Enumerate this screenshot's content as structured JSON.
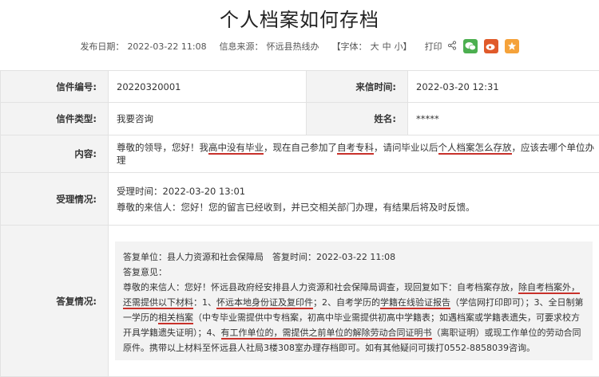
{
  "title": "个人档案如何存档",
  "meta": {
    "publish_label": "发布日期：",
    "publish_date": "2022-03-22 11:08",
    "source_label": "信息来源：",
    "source": "怀远县热线办",
    "font_prefix": "【字体：",
    "font_large": "大",
    "font_medium": "中",
    "font_small": "小】",
    "print": "打印"
  },
  "icons": [
    "share-icon",
    "wechat-icon",
    "weibo-icon",
    "favorite-icon"
  ],
  "colors": {
    "wechat": "#4caf50",
    "weibo": "#e05a2a",
    "favorite": "#f5a23a",
    "underline": "#c8312b"
  },
  "letter": {
    "number_label": "信件编号:",
    "number": "20220320001",
    "time_label": "来信时间:",
    "time": "2022-03-20 12:31",
    "type_label": "信件类型:",
    "type": "我要咨询",
    "name_label": "姓名:",
    "name": "*****",
    "content_label": "内容:",
    "content_1": "尊敬的领导，您好！我",
    "content_2": "高中没有毕业",
    "content_3": "，现在自己参加了",
    "content_4": "自考专科",
    "content_5": "，请问毕业以后",
    "content_6": "个人档案怎么存放",
    "content_7": "，应该去哪个单位办理"
  },
  "acceptance": {
    "label": "受理情况:",
    "time": "受理时间：2022-03-20 13:01",
    "text": "尊敬的来信人：您好！您的留言已经收到，并已交相关部门办理，有结果后将及时反馈。"
  },
  "reply": {
    "label": "答复情况:",
    "unit_line": "答复单位：县人力资源和社会保障局　答复时间：2022-03-22 11:08",
    "opinion_label": "答复意见：",
    "p1": "尊敬的来信人：您好！怀远县政府经安排县人力资源和社会保障局调查，现回复如下：自考档案存放，",
    "p2": "除自考档案外，还需提供以下材料",
    "p3": "：1、",
    "p4": "怀远本地身份证及复印件",
    "p5": "；2、自考学历的",
    "p6": "学籍在线验证报告",
    "p7": "（学信网打印即可）；3、全日制第一学历的",
    "p8": "相关档案",
    "p9": "（中专毕业需提供中专档案，初高中毕业需提供初高中学籍表；如遇档案或学籍表遗失，可要求校方开具学籍遗失证明）；4、",
    "p10": "有工作单位的，需提供之前单位的解除劳动合同证明书",
    "p11": "（离职证明）或现工作单位的劳动合同原件。携带以上材料至怀远县人社局3楼308室办理存档即可。如有其他疑问可拨打0552-8858039咨询。"
  }
}
